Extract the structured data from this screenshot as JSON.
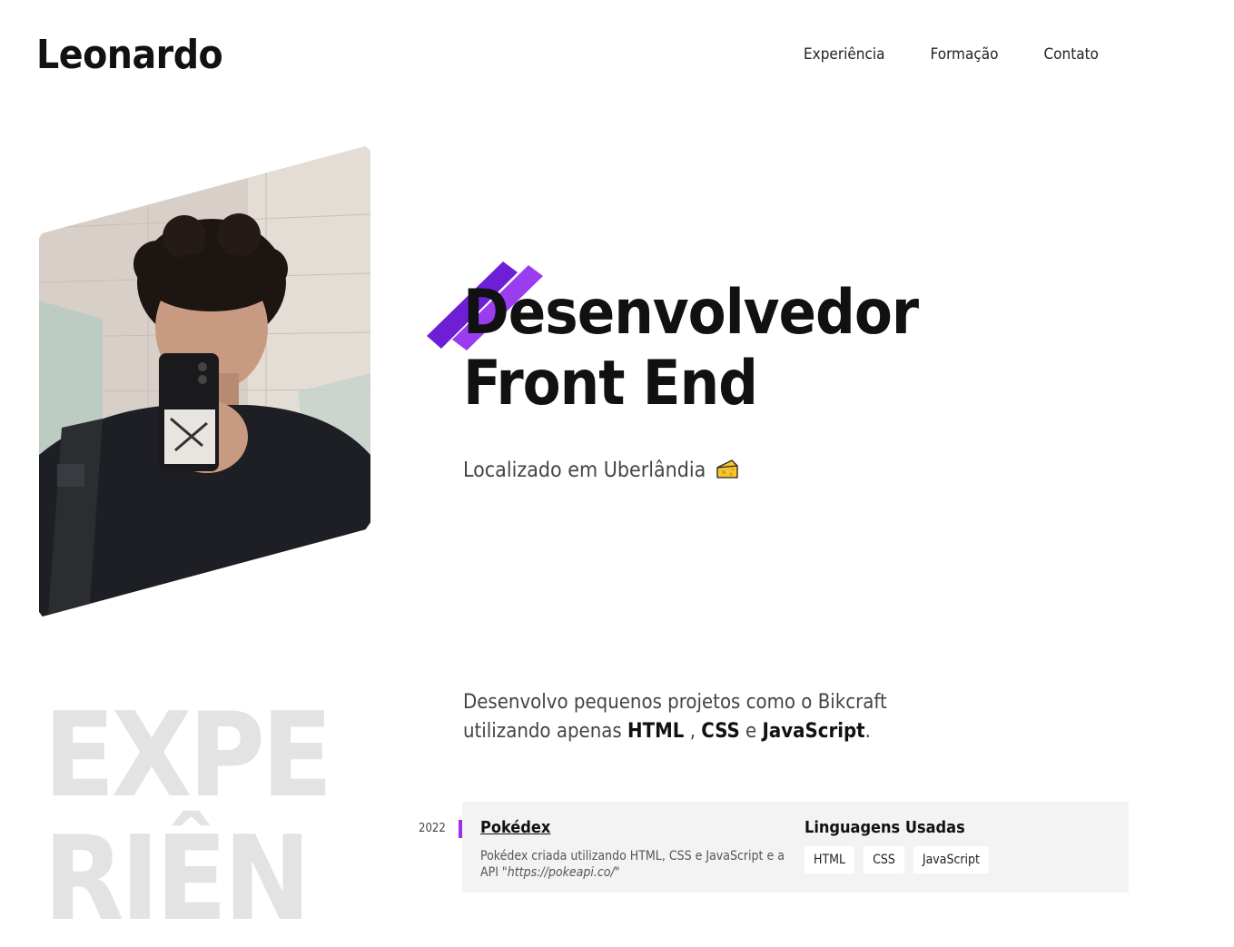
{
  "header": {
    "logo": "Leonardo",
    "nav": [
      "Experiência",
      "Formação",
      "Contato"
    ]
  },
  "hero": {
    "title_line1": "Desenvolvedor",
    "title_line2": "Front End",
    "location": "Localizado em Uberlândia",
    "location_icon": "cheese-icon",
    "accent_color": "#8a2be2"
  },
  "experience": {
    "bg_word_line1": "EXPE",
    "bg_word_line2": "RIÊN",
    "intro_prefix": "Desenvolvo pequenos projetos como o Bikcraft utilizando apenas",
    "intro_html": "HTML",
    "intro_sep1": ",",
    "intro_css": "CSS",
    "intro_sep2": "e",
    "intro_js": "JavaScript",
    "intro_suffix": ".",
    "items": [
      {
        "year": "2022",
        "title": "Pokédex",
        "desc_prefix": "Pokédex criada utilizando HTML, CSS e JavaScript e a API",
        "desc_link": "\"https://pokeapi.co/\"",
        "langs_title": "Linguagens Usadas",
        "langs": [
          "HTML",
          "CSS",
          "JavaScript"
        ]
      }
    ]
  }
}
